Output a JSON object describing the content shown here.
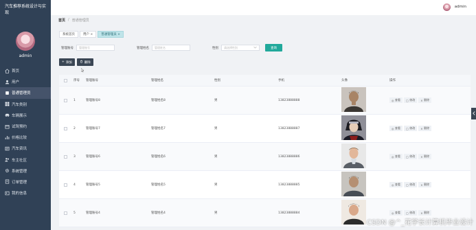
{
  "app": {
    "title": "汽车推荐系统设计与实现",
    "user": "admin"
  },
  "sidebar": {
    "items": [
      {
        "label": "首页",
        "icon": "home-icon"
      },
      {
        "label": "用户",
        "icon": "user-icon"
      },
      {
        "label": "普通管理员",
        "icon": "admin-icon",
        "active": true
      },
      {
        "label": "汽车类别",
        "icon": "category-icon"
      },
      {
        "label": "车辆展示",
        "icon": "car-icon"
      },
      {
        "label": "试驾预约",
        "icon": "calendar-icon"
      },
      {
        "label": "价格比较",
        "icon": "compare-icon"
      },
      {
        "label": "汽车资讯",
        "icon": "news-icon"
      },
      {
        "label": "车主社区",
        "icon": "community-icon"
      },
      {
        "label": "系统管理",
        "icon": "gear-icon"
      },
      {
        "label": "订单管理",
        "icon": "order-icon"
      },
      {
        "label": "我的信息",
        "icon": "profile-icon"
      }
    ]
  },
  "header": {
    "user": "admin"
  },
  "breadcrumb": {
    "home": "首页",
    "separator": "/",
    "current": "普通管理员"
  },
  "tabs": [
    {
      "label": "系统首页",
      "closable": false
    },
    {
      "label": "用户",
      "closable": true
    },
    {
      "label": "普通管理员",
      "closable": true,
      "active": true
    }
  ],
  "search": {
    "account_label": "管理账号",
    "account_placeholder": "管理账号",
    "name_label": "管理姓名",
    "name_placeholder": "管理姓名",
    "gender_label": "性别",
    "gender_placeholder": "请选择性别",
    "query_button": "查询"
  },
  "toolbar": {
    "add_label": "添加",
    "delete_label": "删除"
  },
  "table": {
    "columns": [
      "序号",
      "管理账号",
      "管理姓名",
      "性别",
      "手机",
      "头像",
      "操作"
    ],
    "rows": [
      {
        "index": "1",
        "account": "管理账号8",
        "name": "管理姓名8",
        "gender": "男",
        "phone": "13823888888"
      },
      {
        "index": "2",
        "account": "管理账号7",
        "name": "管理姓名7",
        "gender": "男",
        "phone": "13823888887"
      },
      {
        "index": "3",
        "account": "管理账号6",
        "name": "管理姓名6",
        "gender": "男",
        "phone": "13823888886"
      },
      {
        "index": "4",
        "account": "管理账号5",
        "name": "管理姓名5",
        "gender": "男",
        "phone": "13823888885"
      },
      {
        "index": "5",
        "account": "管理账号4",
        "name": "管理姓名4",
        "gender": "男",
        "phone": "13823888884"
      }
    ],
    "ops": {
      "view": "查看",
      "edit": "修改",
      "delete": "删除"
    }
  },
  "watermark": "CSDN @^_花学长计算机毕业设计",
  "colors": {
    "sidebar": "#304156",
    "accent": "#21a99b",
    "tab_active": "#bfe4e9",
    "button_dark": "#3a4654"
  }
}
